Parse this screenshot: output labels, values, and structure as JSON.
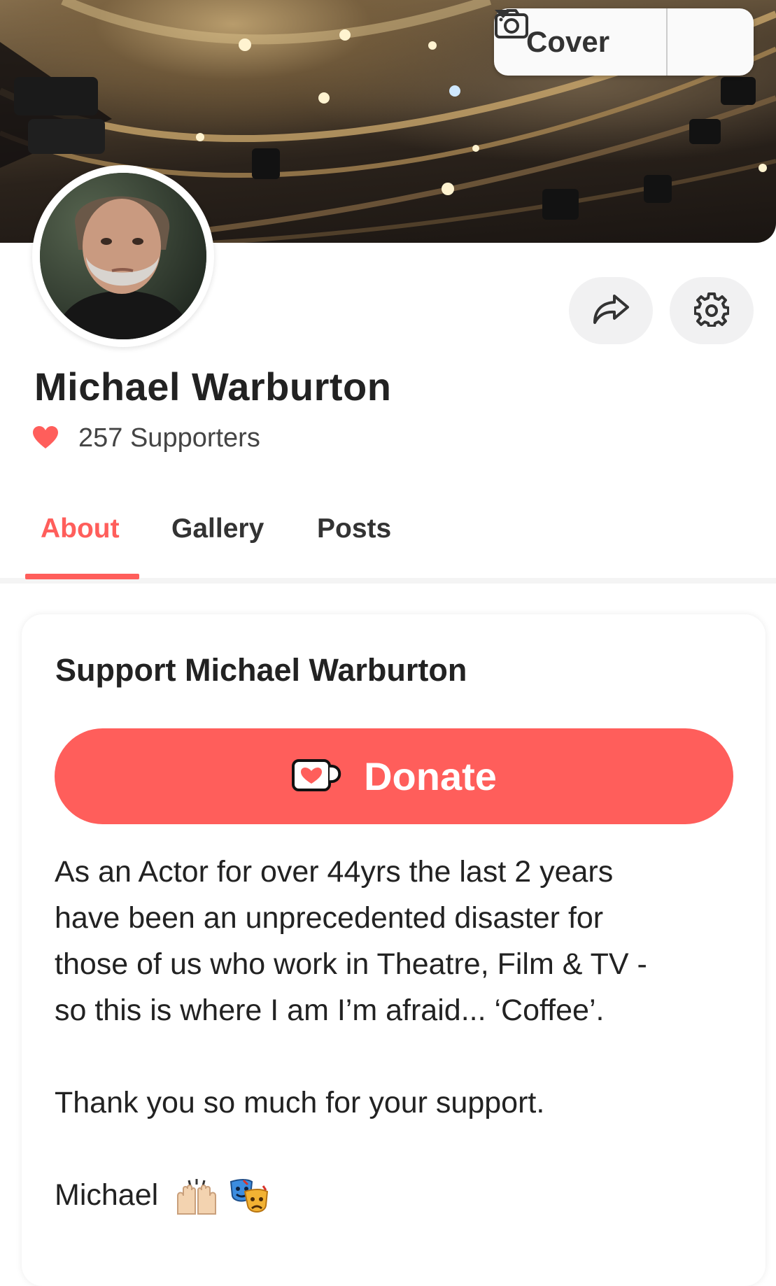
{
  "cover": {
    "button_label": "Cover"
  },
  "profile": {
    "name": "Michael Warburton",
    "supporters_text": "257 Supporters"
  },
  "tabs": [
    {
      "label": "About",
      "active": true
    },
    {
      "label": "Gallery",
      "active": false
    },
    {
      "label": "Posts",
      "active": false
    }
  ],
  "support_card": {
    "title": "Support Michael Warburton",
    "donate_label": "Donate",
    "body_lines": [
      "As an Actor for over 44yrs the last 2 years",
      "have been an unprecedented disaster for",
      "those of us who work in Theatre, Film & TV -",
      "so this is where I am I’m afraid... ‘Coffee’."
    ],
    "thanks": "Thank you so much for your support.",
    "signature": "Michael"
  },
  "icons": {
    "cover_button": "camera-icon",
    "cover_dropdown": "caret-down-icon",
    "share": "share-arrow-icon",
    "settings": "gear-icon",
    "supporters": "heart-icon",
    "donate": "coffee-cup-heart-icon",
    "signature_emoji": [
      "raising-hands-emoji",
      "performing-arts-emoji"
    ]
  },
  "colors": {
    "accent": "#ff5e5b",
    "muted_button": "#f1f1f2"
  }
}
